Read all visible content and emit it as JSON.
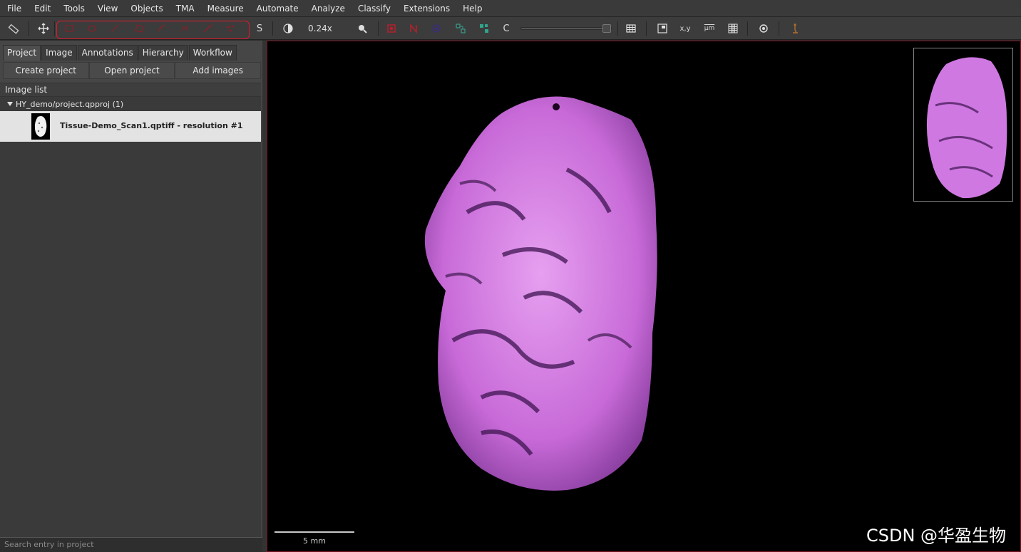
{
  "menu": [
    "File",
    "Edit",
    "Tools",
    "View",
    "Objects",
    "TMA",
    "Measure",
    "Automate",
    "Analyze",
    "Classify",
    "Extensions",
    "Help"
  ],
  "toolbar": {
    "selection_mode_label": "S",
    "zoom_value": "0.24x",
    "channel_c_label": "C",
    "coords_label": "x,y",
    "scale_label": "µm",
    "highlight_color": "#e0192a"
  },
  "left_panel": {
    "tabs": [
      "Project",
      "Image",
      "Annotations",
      "Hierarchy",
      "Workflow"
    ],
    "buttons": [
      "Create project",
      "Open project",
      "Add images"
    ],
    "list_header": "Image list",
    "project": "HY_demo/project.qpproj (1)",
    "image_entry": "Tissue-Demo_Scan1.qptiff - resolution #1",
    "search_placeholder": "Search entry in project"
  },
  "viewer": {
    "scale_bar_label": "5 mm",
    "watermark": "CSDN @华盈生物",
    "tissue_color": "#d77ee6"
  }
}
